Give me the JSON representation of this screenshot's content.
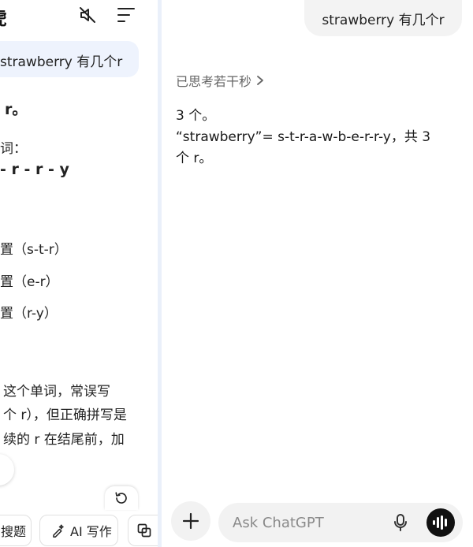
{
  "left": {
    "title": "虎",
    "user_message": "strawberry 有几个r",
    "lines": [
      "r。",
      "词：",
      "- r - r - y",
      "置（s-t-r）",
      "置（e-r）",
      "置（r-y）",
      "这个单词，常误写",
      "个 r），但正确拼写是",
      "续的 r 在结尾前，加"
    ],
    "chips": [
      "搜题",
      "AI 写作"
    ]
  },
  "right": {
    "user_message": "strawberry 有几个r",
    "thought_label": "已思考若干秒",
    "answer": {
      "line1": "3 个。",
      "line2": "“strawberry”= s-t-r-a-w-b-e-r-r-y，共 3",
      "line3": "个 r。"
    },
    "composer": {
      "placeholder": "Ask ChatGPT"
    }
  }
}
